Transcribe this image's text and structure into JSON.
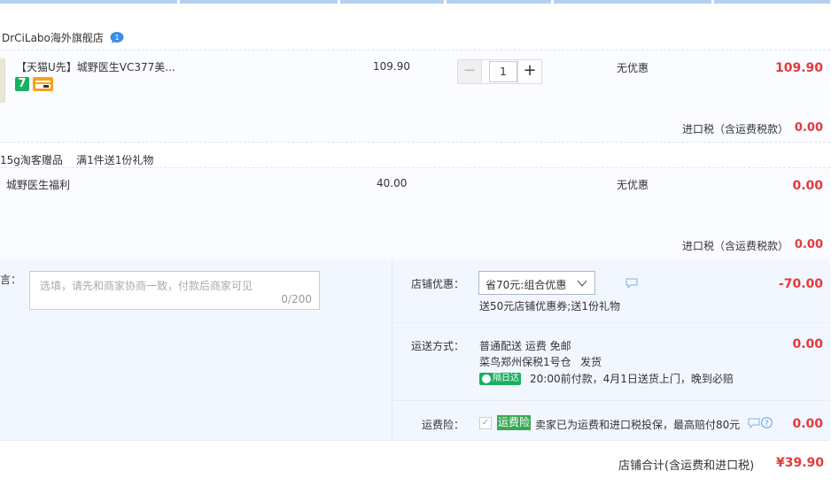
{
  "shop": {
    "name": "DrCiLabo海外旗舰店",
    "chat_badge": "1"
  },
  "item1": {
    "title": "【天猫U先】城野医生VC377美...",
    "badge_7": "7",
    "price": "109.90",
    "quantity": "1",
    "qty_minus": "−",
    "qty_plus": "+",
    "promo": "无优惠",
    "subtotal": "109.90",
    "tax_label": "进口税（含运费税款）",
    "tax_value": "0.00"
  },
  "gift": {
    "header": "15g淘客赠品    满1件送1份礼物",
    "title": "城野医生福利",
    "price": "40.00",
    "promo": "无优惠",
    "subtotal": "0.00",
    "tax_label": "进口税（含运费税款）",
    "tax_value": "0.00"
  },
  "memo": {
    "label": "留言：",
    "placeholder": "选填，请先和商家协商一致，付款后商家可见",
    "count": "0/200"
  },
  "shop_discount": {
    "label": "店铺优惠：",
    "selected": "省70元:组合优惠",
    "note": "送50元店铺优惠券;送1份礼物",
    "value": "-70.00"
  },
  "shipping": {
    "label": "运送方式：",
    "method": "普通配送 运费 免邮",
    "warehouse": "菜鸟郑州保税1号仓",
    "ship_text": "发货",
    "badge": "隔日达",
    "eta": "20:00前付款，4月1日送货上门，晚到必赔",
    "value": "0.00"
  },
  "insurance": {
    "label": "运费险：",
    "tag": "运费险",
    "text": "卖家已为运费和进口税投保，最高赔付80元",
    "value": "0.00"
  },
  "total": {
    "label": "店铺合计(含运费和进口税)",
    "value": "¥39.90"
  },
  "colors": {
    "accent_red": "#e4393c",
    "green": "#19b061",
    "panel_bg": "#f2f7ff"
  }
}
